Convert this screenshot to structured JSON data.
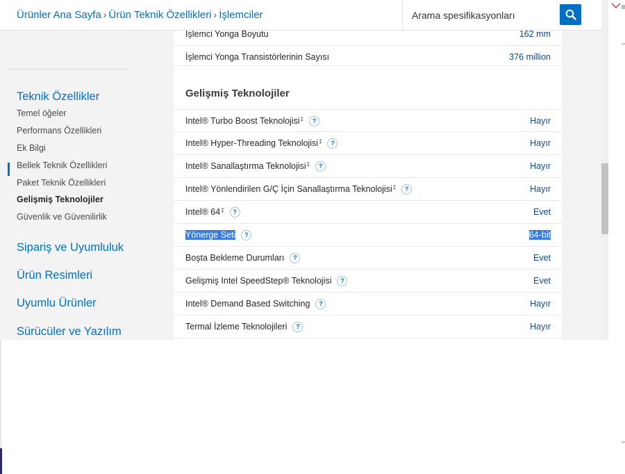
{
  "breadcrumb": {
    "items": [
      "Ürünler Ana Sayfa",
      "Ürün Teknik Özellikleri",
      "İşlemciler"
    ],
    "separator": "›"
  },
  "search": {
    "placeholder": "Arama spesifikasyonları",
    "icon": "search-icon"
  },
  "sidebar": {
    "section_title": "Teknik Özellikler",
    "items": [
      "Temel öğeler",
      "Performans Özellikleri",
      "Ek Bilgi",
      "Bellek Teknik Özellikleri",
      "Paket Teknik Özellikleri",
      "Gelişmiş Teknolojiler",
      "Güvenlik ve Güvenilirlik"
    ],
    "active_item": "Gelişmiş Teknolojiler",
    "links": [
      "Sipariş ve Uyumluluk",
      "Ürün Resimleri",
      "Uyumlu Ürünler",
      "Sürücüler ve Yazılım"
    ]
  },
  "top_rows": [
    {
      "label": "İşlemci Yonga Boyutu",
      "value": "162 mm"
    },
    {
      "label": "İşlemci Yonga Transistörlerinin Sayısı",
      "value": "376 million"
    }
  ],
  "section": {
    "heading": "Gelişmiş Teknolojiler",
    "rows": [
      {
        "label": "Intel® Turbo Boost Teknolojisi",
        "dagger": "‡",
        "value": "Hayır"
      },
      {
        "label": "Intel® Hyper-Threading Teknolojisi",
        "dagger": "‡",
        "value": "Hayır"
      },
      {
        "label": "Intel® Sanallaştırma Teknolojisi",
        "dagger": "‡",
        "value": "Hayır"
      },
      {
        "label": "Intel® Yönlendirilen G/Ç İçin Sanallaştırma Teknolojisi",
        "dagger": "‡",
        "value": "Hayır"
      },
      {
        "label": "Intel® 64",
        "dagger": "‡",
        "value": "Evet"
      },
      {
        "label": "Yönerge Seti",
        "dagger": "",
        "value": "64-bit",
        "selected": true
      },
      {
        "label": "Boşta Bekleme Durumları",
        "dagger": "",
        "value": "Evet"
      },
      {
        "label": "Gelişmiş Intel SpeedStep® Teknolojisi",
        "dagger": "",
        "value": "Evet"
      },
      {
        "label": "Intel® Demand Based Switching",
        "dagger": "",
        "value": "Hayır"
      },
      {
        "label": "Termal İzleme Teknolojileri",
        "dagger": "",
        "value": "Hayır"
      }
    ],
    "help_icon": {
      "name": "help-icon",
      "glyph": "?"
    }
  },
  "colors": {
    "accent": "#0071c5",
    "selection": "#3b7bdc",
    "sidebar_bg": "#f3f3f3"
  }
}
